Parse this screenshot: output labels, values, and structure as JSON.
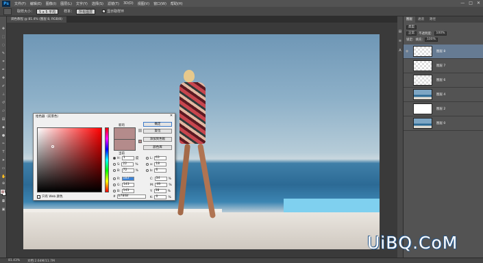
{
  "app": {
    "logo": "Ps"
  },
  "menubar": {
    "items": [
      "文件(F)",
      "编辑(E)",
      "图像(I)",
      "图层(L)",
      "文字(Y)",
      "选择(S)",
      "滤镜(T)",
      "3D(D)",
      "视图(V)",
      "窗口(W)",
      "帮助(H)"
    ],
    "window_controls": [
      "—",
      "□",
      "✕"
    ]
  },
  "optionsbar": {
    "size_label": "取样大小：",
    "size_value": "5 x 5 平均",
    "sample_label": "样本：",
    "sample_value": "所有图层",
    "ring_label": "显示取样环",
    "ring_checked": true
  },
  "document": {
    "tab_title": "调色教程 @ 81.4% (图层 8, RGB/8)",
    "zoom": "81.43%",
    "doc_info": "文档:2.64M/11.7M"
  },
  "color_picker": {
    "title": "拾色器（前景色）",
    "new_label": "新的",
    "current_label": "当前",
    "new_color": "#b48b8b",
    "current_color": "#b48b8b",
    "buttons": {
      "ok": "确定",
      "cancel": "复位",
      "add_swatch": "添加到色板",
      "libraries": "颜色库"
    },
    "hsb": [
      {
        "label": "H:",
        "value": "1",
        "unit": "度",
        "selected": true
      },
      {
        "label": "S:",
        "value": "22",
        "unit": "%"
      },
      {
        "label": "B:",
        "value": "72",
        "unit": "%"
      }
    ],
    "rgb": [
      {
        "label": "R:",
        "value": "183",
        "unit": ""
      },
      {
        "label": "G:",
        "value": "143",
        "unit": ""
      },
      {
        "label": "B:",
        "value": "143",
        "unit": ""
      }
    ],
    "lab": [
      {
        "label": "L:",
        "value": "63",
        "unit": ""
      },
      {
        "label": "a:",
        "value": "18",
        "unit": ""
      },
      {
        "label": "b:",
        "value": "6",
        "unit": ""
      }
    ],
    "cmyk": [
      {
        "label": "C:",
        "value": "34",
        "unit": "%"
      },
      {
        "label": "M:",
        "value": "49",
        "unit": "%"
      },
      {
        "label": "Y:",
        "value": "38",
        "unit": "%"
      },
      {
        "label": "K:",
        "value": "0",
        "unit": "%"
      }
    ],
    "only_web_label": "只有 Web 颜色",
    "hex_label": "#",
    "hex_value": "b78f8f"
  },
  "layers_panel": {
    "tabs": [
      "图层",
      "通道",
      "路径"
    ],
    "kind_label": "类型",
    "blend_mode": "正常",
    "opacity_label": "不透明度:",
    "opacity_value": "100%",
    "lock_label": "锁定:",
    "fill_label": "填充:",
    "fill_value": "100%",
    "layers": [
      {
        "name": "图层 8",
        "thumb": "trans",
        "active": true
      },
      {
        "name": "图层 7",
        "thumb": "trans",
        "active": false
      },
      {
        "name": "图层 6",
        "thumb": "trans",
        "active": false
      },
      {
        "name": "图层 4",
        "thumb": "photo",
        "active": false
      },
      {
        "name": "图层 2",
        "thumb": "white",
        "active": false
      },
      {
        "name": "图层 0",
        "thumb": "photo",
        "active": false
      }
    ]
  },
  "watermark": {
    "text": "UiBQ.CoM"
  }
}
